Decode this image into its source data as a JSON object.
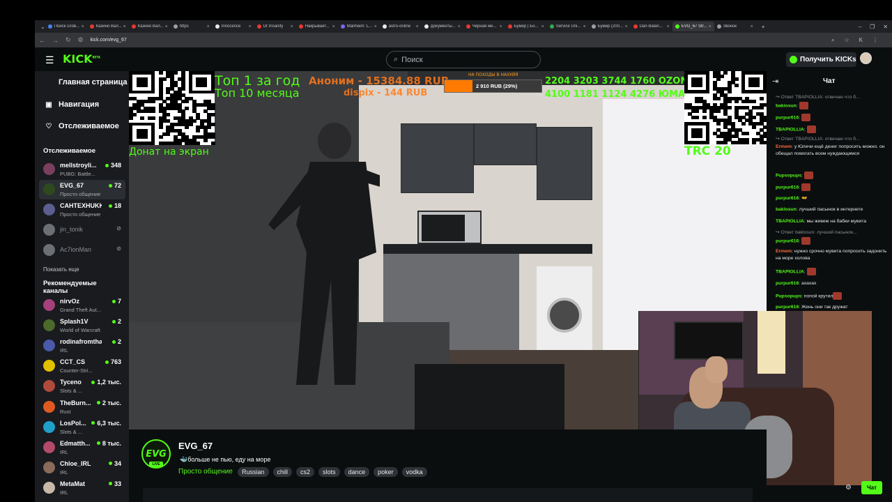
{
  "browser": {
    "tabs": [
      {
        "label": "Поиск слов...",
        "color": "#4285f4"
      },
      {
        "label": "Казино Вал...",
        "color": "#e53935"
      },
      {
        "label": "Казино Вал...",
        "color": "#e53935"
      },
      {
        "label": "https",
        "color": "#9aa0a6"
      },
      {
        "label": "Innocence",
        "color": "#e8eaed"
      },
      {
        "label": "Dr Insanity",
        "color": "#e53935"
      },
      {
        "label": "Накрывает...",
        "color": "#e53935"
      },
      {
        "label": "Manheim: L...",
        "color": "#7b68ee"
      },
      {
        "label": "astro-online",
        "color": "#e8eaed"
      },
      {
        "label": "Документы...",
        "color": "#e8eaed"
      },
      {
        "label": "Черная ме...",
        "color": "#e53935"
      },
      {
        "label": "Бумер | Бо...",
        "color": "#e53935"
      },
      {
        "label": "Service Uni...",
        "color": "#34a853"
      },
      {
        "label": "Бумер (200...",
        "color": "#9aa0a6"
      },
      {
        "label": "Dan Balan...",
        "color": "#e53935"
      },
      {
        "label": "EVG_67 Str...",
        "color": "#53fc18",
        "active": true
      },
      {
        "label": "Звонок",
        "color": "#9aa0a6"
      }
    ],
    "url": "kick.com/evg_67"
  },
  "header": {
    "logo": "KICK",
    "logo_sup": "BETA",
    "search_placeholder": "Поиск",
    "get_kicks": "Получить KICKs"
  },
  "sidebar": {
    "nav": [
      {
        "label": "Главная страница",
        "icon": "home-icon"
      },
      {
        "label": "Навигация",
        "icon": "compass-icon"
      },
      {
        "label": "Отслеживаемое",
        "icon": "heart-icon"
      }
    ],
    "following_heading": "Отслеживаемое",
    "following": [
      {
        "name": "mellstroyli...",
        "category": "PUBG: Battle...",
        "viewers": "348",
        "avatar": "#7a3f5e"
      },
      {
        "name": "EVG_67",
        "category": "Просто общение",
        "viewers": "72",
        "avatar": "#2d4a1f",
        "selected": true
      },
      {
        "name": "CAHTEXHUKK",
        "category": "Просто общение",
        "viewers": "18",
        "avatar": "#5b5e8f"
      },
      {
        "name": "jin_tonik",
        "category": "",
        "viewers": "",
        "offline": true,
        "avatar": "#6c6f73"
      },
      {
        "name": "Ac7ionMan",
        "category": "",
        "viewers": "",
        "offline": true,
        "avatar": "#6c6f73"
      }
    ],
    "show_more": "Показать еще",
    "recommended_heading": "Рекомендуемые каналы",
    "recommended": [
      {
        "name": "nirvOz",
        "category": "Grand Theft Aut...",
        "viewers": "7",
        "avatar": "#a4407a"
      },
      {
        "name": "Splash1V",
        "category": "World of Warcraft",
        "viewers": "2",
        "avatar": "#4c6a2a"
      },
      {
        "name": "rodinafromthai",
        "category": "IRL",
        "viewers": "2",
        "avatar": "#4a5aa8"
      },
      {
        "name": "CCT_CS",
        "category": "Counter-Stri...",
        "viewers": "763",
        "avatar": "#e0c000"
      },
      {
        "name": "Tyceno",
        "category": "Slots & ...",
        "viewers": "1,2 тыс.",
        "avatar": "#b04a3a"
      },
      {
        "name": "TheBurn...",
        "category": "Rust",
        "viewers": "2 тыс.",
        "avatar": "#e05a20"
      },
      {
        "name": "LosPol...",
        "category": "Slots & ...",
        "viewers": "6,3 тыс.",
        "avatar": "#1ea0c8"
      },
      {
        "name": "Edmatth...",
        "category": "IRL",
        "viewers": "8 тыс.",
        "avatar": "#b44a6a"
      },
      {
        "name": "Chloe_IRL",
        "category": "IRL",
        "viewers": "34",
        "avatar": "#8a6a5a"
      },
      {
        "name": "MetaMat",
        "category": "IRL",
        "viewers": "33",
        "avatar": "#c8b8a8"
      }
    ]
  },
  "overlay": {
    "top1": "Топ 1 за год",
    "top10": "Топ 10 месяца",
    "anon": "Аноним - 15384.88 RUB",
    "dispix": "dispix - 144 RUB",
    "goal_label": "НА ПОХОДЫ В НАХУЙЯ",
    "goal_amount": "2 910 RUB (29%)",
    "goal_progress": 0.29,
    "goal_min": "0",
    "goal_max": "10 000",
    "ozon": "2204 3203 3744 1760 OZON МИР",
    "yoomoney": "4100 1181 1124 4276 ЮМАНИ",
    "donat": "Донат на экран",
    "trc": "TRC 20"
  },
  "chat": {
    "title": "Чат",
    "messages": [
      {
        "reply": "↪ Ответ TBAPIOLLIA: отвечаю что б..."
      },
      {
        "user": "bakiosun",
        "color": "#53fc18",
        "text": "",
        "emote": true
      },
      {
        "user": "purpur616",
        "color": "#53fc18",
        "text": "",
        "emote": true
      },
      {
        "user": "TBAPIOLLIA",
        "color": "#53fc18",
        "text": "",
        "emote": true
      },
      {
        "reply": "↪ Ответ TBAPIOLLIA: отвечаю что б..."
      },
      {
        "user": "Ermem",
        "color": "#ff6a3d",
        "text": "у Юличи ещё денег попросить можно. он обещал помогать всем нуждающимся"
      },
      {
        "user": "Pupsopups",
        "color": "#53fc18",
        "text": "",
        "emote": true
      },
      {
        "user": "purpur616",
        "color": "#53fc18",
        "text": "",
        "emote": true
      },
      {
        "user": "purpur616",
        "color": "#53fc18",
        "text": "👐"
      },
      {
        "user": "baklosun",
        "color": "#53fc18",
        "text": "лучший пасынок в интернете"
      },
      {
        "user": "TBAPIOLLIA",
        "color": "#53fc18",
        "text": "мы живем на бабки мувита"
      },
      {
        "reply": "↪ Ответ baklosun: лучший пасынок..."
      },
      {
        "user": "purpur616",
        "color": "#53fc18",
        "text": "",
        "emote": true
      },
      {
        "user": "Ermem",
        "color": "#ff6a3d",
        "text": "нужно срочно мувита попросить задонить на море холова"
      },
      {
        "user": "TBAPIOLLIA",
        "color": "#53fc18",
        "text": "",
        "emote": true
      },
      {
        "user": "purpur616",
        "color": "#53fc18",
        "text": "ахахах"
      },
      {
        "user": "Pupsopups",
        "color": "#53fc18",
        "text": "попой крутил",
        "emote": true
      },
      {
        "user": "purpur616",
        "color": "#53fc18",
        "text": "Жень они так дружат"
      }
    ],
    "button": "Чат"
  },
  "stream": {
    "channel": "EVG_67",
    "avatar_text": "EVG",
    "live": "LIVE",
    "title": "больше не пью, еду на море",
    "category": "Просто общение",
    "tags": [
      "Russian",
      "chill",
      "cs2",
      "slots",
      "dance",
      "poker",
      "vodka"
    ]
  }
}
